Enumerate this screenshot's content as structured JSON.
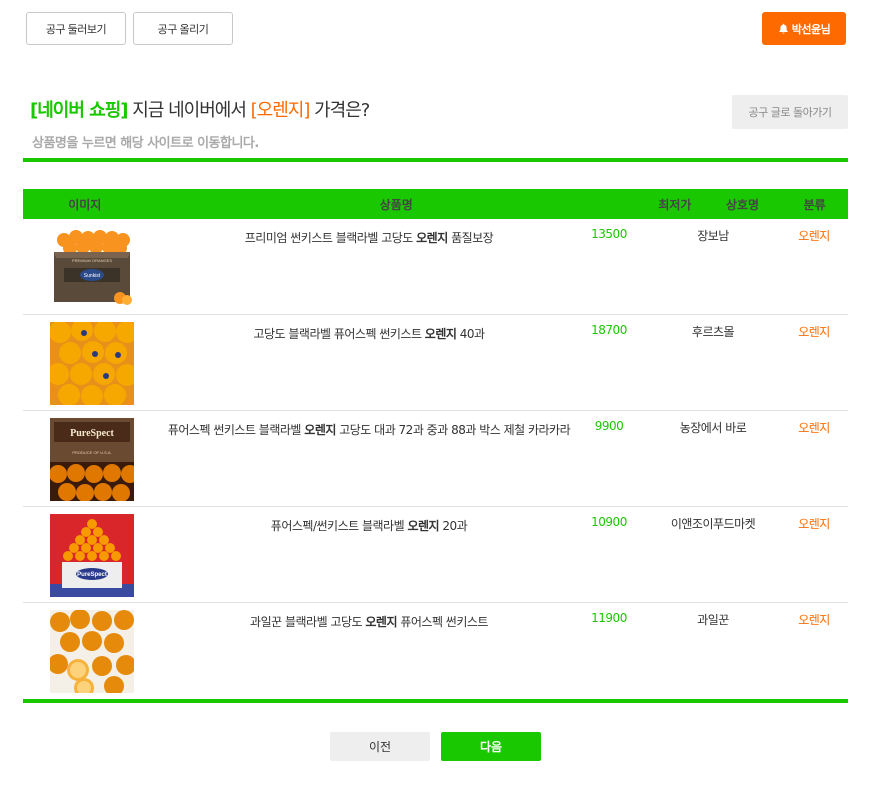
{
  "header": {
    "browse_label": "공구 둘러보기",
    "post_label": "공구 올리기",
    "user_label": "박선윤님"
  },
  "title": {
    "part1": "[네이버 쇼핑]",
    "part2": " 지금 네이버에서 ",
    "part3": "[오렌지]",
    "part4": " 가격은?"
  },
  "subtitle": "상품명을 누르면 해당 사이트로 이동합니다.",
  "back_label": "공구 글로 돌아가기",
  "table": {
    "headers": [
      "이미지",
      "상품명",
      "최저가",
      "상호명",
      "분류"
    ],
    "rows": [
      {
        "name_pre": "프리미엄 썬키스트 블랙라벨 고당도 ",
        "name_key": "오렌지",
        "name_post": " 품질보장",
        "price": "13500",
        "shop": "장보남",
        "category": "오렌지"
      },
      {
        "name_pre": "고당도 블랙라벨 퓨어스펙 썬키스트 ",
        "name_key": "오렌지",
        "name_post": " 40과",
        "price": "18700",
        "shop": "후르츠몰",
        "category": "오렌지"
      },
      {
        "name_pre": "퓨어스펙 썬키스트 블랙라벨 ",
        "name_key": "오렌지",
        "name_post": " 고당도 대과 72과 중과 88과 박스 제철 카라카라",
        "price": "9900",
        "shop": "농장에서 바로",
        "category": "오렌지"
      },
      {
        "name_pre": "퓨어스펙/썬키스트 블랙라벨 ",
        "name_key": "오렌지",
        "name_post": " 20과",
        "price": "10900",
        "shop": "이앤조이푸드마켓",
        "category": "오렌지"
      },
      {
        "name_pre": "과일꾼 블랙라벨 고당도 ",
        "name_key": "오렌지",
        "name_post": " 퓨어스펙 썬키스트",
        "price": "11900",
        "shop": "과일꾼",
        "category": "오렌지"
      }
    ]
  },
  "images": [
    {
      "box_text": "PREMIUM ORANGES",
      "brand": "Sunkist"
    },
    {},
    {
      "brand": "PureSpect",
      "sub": "PRODUCE OF U.S.A."
    },
    {
      "brand": "PureSpect"
    },
    {}
  ],
  "pager": {
    "prev_label": "이전",
    "next_label": "다음"
  },
  "colors": {
    "green": "#1ac800",
    "orange": "#ff6a00"
  }
}
